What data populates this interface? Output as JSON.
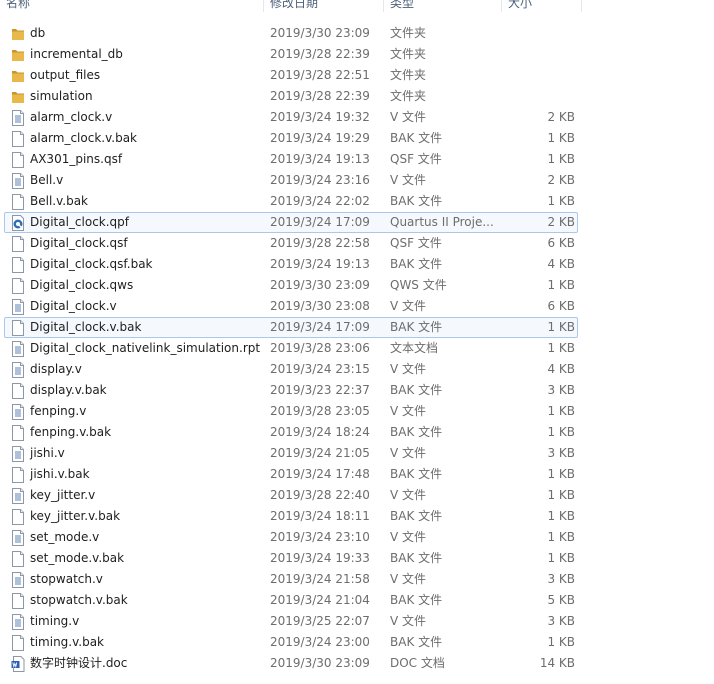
{
  "header": {
    "name": "名称",
    "date": "修改日期",
    "type": "类型",
    "size": "大小"
  },
  "files": [
    {
      "name": "db",
      "date": "2019/3/30 23:09",
      "type": "文件夹",
      "size": "",
      "icon": "folder-icon"
    },
    {
      "name": "incremental_db",
      "date": "2019/3/28 22:39",
      "type": "文件夹",
      "size": "",
      "icon": "folder-icon"
    },
    {
      "name": "output_files",
      "date": "2019/3/28 22:51",
      "type": "文件夹",
      "size": "",
      "icon": "folder-icon"
    },
    {
      "name": "simulation",
      "date": "2019/3/28 22:39",
      "type": "文件夹",
      "size": "",
      "icon": "folder-icon"
    },
    {
      "name": "alarm_clock.v",
      "date": "2019/3/24 19:32",
      "type": "V 文件",
      "size": "2 KB",
      "icon": "text-file-icon"
    },
    {
      "name": "alarm_clock.v.bak",
      "date": "2019/3/24 19:29",
      "type": "BAK 文件",
      "size": "1 KB",
      "icon": "blank-file-icon"
    },
    {
      "name": "AX301_pins.qsf",
      "date": "2019/3/24 19:13",
      "type": "QSF 文件",
      "size": "1 KB",
      "icon": "blank-file-icon"
    },
    {
      "name": "Bell.v",
      "date": "2019/3/24 23:16",
      "type": "V 文件",
      "size": "2 KB",
      "icon": "text-file-icon"
    },
    {
      "name": "Bell.v.bak",
      "date": "2019/3/24 22:02",
      "type": "BAK 文件",
      "size": "1 KB",
      "icon": "blank-file-icon"
    },
    {
      "name": "Digital_clock.qpf",
      "date": "2019/3/24 17:09",
      "type": "Quartus II Proje...",
      "size": "2 KB",
      "icon": "quartus-project-icon",
      "highlight": true
    },
    {
      "name": "Digital_clock.qsf",
      "date": "2019/3/28 22:58",
      "type": "QSF 文件",
      "size": "6 KB",
      "icon": "blank-file-icon"
    },
    {
      "name": "Digital_clock.qsf.bak",
      "date": "2019/3/24 19:13",
      "type": "BAK 文件",
      "size": "4 KB",
      "icon": "blank-file-icon"
    },
    {
      "name": "Digital_clock.qws",
      "date": "2019/3/30 23:09",
      "type": "QWS 文件",
      "size": "1 KB",
      "icon": "blank-file-icon"
    },
    {
      "name": "Digital_clock.v",
      "date": "2019/3/30 23:08",
      "type": "V 文件",
      "size": "6 KB",
      "icon": "text-file-icon"
    },
    {
      "name": "Digital_clock.v.bak",
      "date": "2019/3/24 17:09",
      "type": "BAK 文件",
      "size": "1 KB",
      "icon": "blank-file-icon",
      "highlight": true
    },
    {
      "name": "Digital_clock_nativelink_simulation.rpt",
      "date": "2019/3/28 23:06",
      "type": "文本文档",
      "size": "1 KB",
      "icon": "text-file-icon"
    },
    {
      "name": "display.v",
      "date": "2019/3/24 23:15",
      "type": "V 文件",
      "size": "4 KB",
      "icon": "text-file-icon"
    },
    {
      "name": "display.v.bak",
      "date": "2019/3/23 22:37",
      "type": "BAK 文件",
      "size": "3 KB",
      "icon": "blank-file-icon"
    },
    {
      "name": "fenping.v",
      "date": "2019/3/28 23:05",
      "type": "V 文件",
      "size": "1 KB",
      "icon": "text-file-icon"
    },
    {
      "name": "fenping.v.bak",
      "date": "2019/3/24 18:24",
      "type": "BAK 文件",
      "size": "1 KB",
      "icon": "blank-file-icon"
    },
    {
      "name": "jishi.v",
      "date": "2019/3/24 21:05",
      "type": "V 文件",
      "size": "3 KB",
      "icon": "text-file-icon"
    },
    {
      "name": "jishi.v.bak",
      "date": "2019/3/24 17:48",
      "type": "BAK 文件",
      "size": "1 KB",
      "icon": "blank-file-icon"
    },
    {
      "name": "key_jitter.v",
      "date": "2019/3/28 22:40",
      "type": "V 文件",
      "size": "1 KB",
      "icon": "text-file-icon"
    },
    {
      "name": "key_jitter.v.bak",
      "date": "2019/3/24 18:11",
      "type": "BAK 文件",
      "size": "1 KB",
      "icon": "blank-file-icon"
    },
    {
      "name": "set_mode.v",
      "date": "2019/3/24 23:10",
      "type": "V 文件",
      "size": "1 KB",
      "icon": "text-file-icon"
    },
    {
      "name": "set_mode.v.bak",
      "date": "2019/3/24 19:33",
      "type": "BAK 文件",
      "size": "1 KB",
      "icon": "blank-file-icon"
    },
    {
      "name": "stopwatch.v",
      "date": "2019/3/24 21:58",
      "type": "V 文件",
      "size": "3 KB",
      "icon": "text-file-icon"
    },
    {
      "name": "stopwatch.v.bak",
      "date": "2019/3/24 21:04",
      "type": "BAK 文件",
      "size": "5 KB",
      "icon": "blank-file-icon"
    },
    {
      "name": "timing.v",
      "date": "2019/3/25 22:07",
      "type": "V 文件",
      "size": "3 KB",
      "icon": "text-file-icon"
    },
    {
      "name": "timing.v.bak",
      "date": "2019/3/24 23:00",
      "type": "BAK 文件",
      "size": "1 KB",
      "icon": "blank-file-icon"
    },
    {
      "name": "数字时钟设计.doc",
      "date": "2019/3/30 23:09",
      "type": "DOC 文档",
      "size": "14 KB",
      "icon": "word-document-icon"
    }
  ],
  "colors": {
    "folder": "#e8b84a",
    "folder_dark": "#c9962c",
    "highlight_border": "#a9c8eb",
    "highlight_bg": "#f5f9fe",
    "header_text": "#4c607a"
  }
}
